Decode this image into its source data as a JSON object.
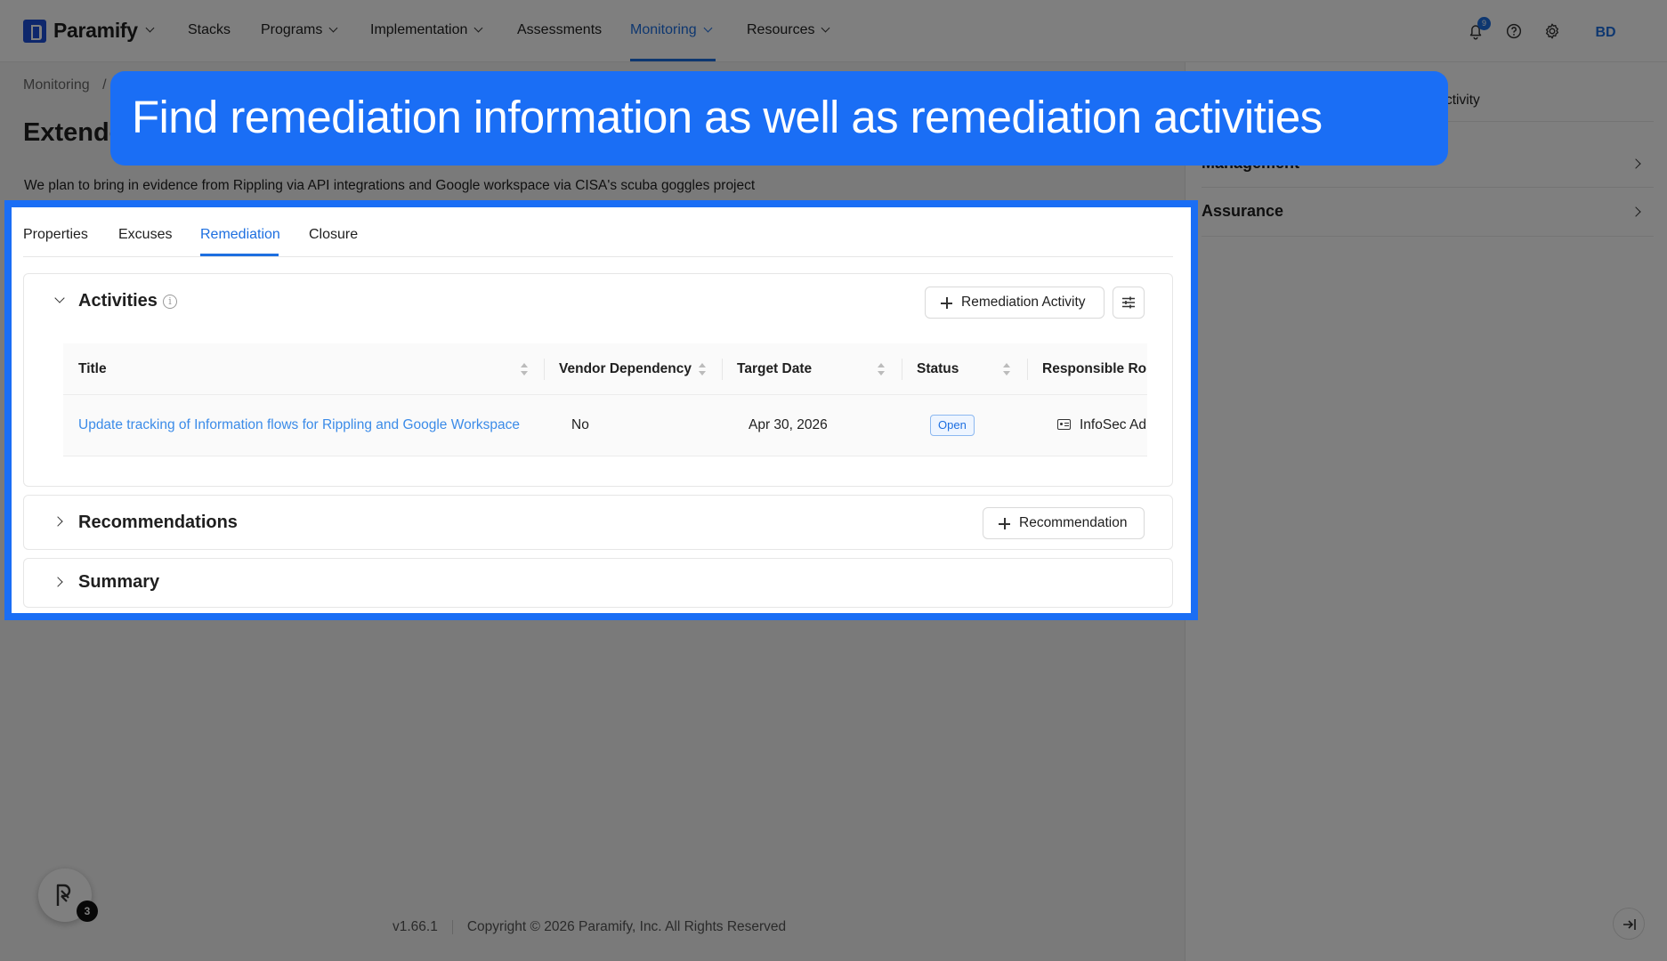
{
  "nav": {
    "brand": "Paramify",
    "items": [
      {
        "label": "Stacks"
      },
      {
        "label": "Programs"
      },
      {
        "label": "Implementation"
      },
      {
        "label": "Assessments"
      },
      {
        "label": "Monitoring"
      },
      {
        "label": "Resources"
      }
    ],
    "active": "Monitoring",
    "notification_count": "9",
    "avatar_initials": "BD"
  },
  "breadcrumb": {
    "root": "Monitoring",
    "separator": "/"
  },
  "page": {
    "title_visible": "Extende",
    "description": "We plan to bring in evidence from Rippling via API integrations and Google workspace via CISA's scuba goggles project"
  },
  "right_panel": {
    "activity_fragment": "ctivity",
    "rows": [
      {
        "label": "Management"
      },
      {
        "label": "Assurance"
      }
    ]
  },
  "tabs": [
    {
      "label": "Properties"
    },
    {
      "label": "Excuses"
    },
    {
      "label": "Remediation"
    },
    {
      "label": "Closure"
    }
  ],
  "active_tab": "Remediation",
  "activities": {
    "title": "Activities",
    "add_button": "Remediation Activity",
    "columns": [
      "Title",
      "Vendor Dependency",
      "Target Date",
      "Status",
      "Responsible Rol"
    ],
    "rows": [
      {
        "title": "Update tracking of Information flows for Rippling and Google Workspace",
        "vendor_dependency": "No",
        "target_date": "Apr 30, 2026",
        "status": "Open",
        "responsible_role": "InfoSec Ad"
      }
    ]
  },
  "recommendations": {
    "title": "Recommendations",
    "add_button": "Recommendation"
  },
  "summary": {
    "title": "Summary"
  },
  "footer": {
    "version": "v1.66.1",
    "copyright": "Copyright © 2026 Paramify, Inc. All Rights Reserved"
  },
  "help_badge_count": "3",
  "callout": {
    "text": "Find remediation information as well as remediation activities"
  },
  "colors": {
    "accent": "#1a6ef5",
    "link": "#3b8be8",
    "overlay": "rgba(0,0,0,0.5)"
  }
}
